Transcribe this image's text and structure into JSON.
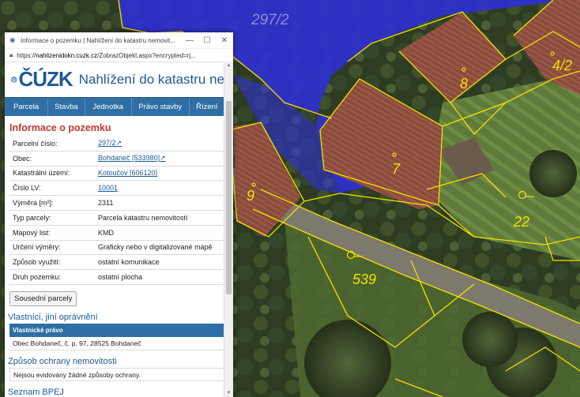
{
  "window": {
    "title": "Informace o pozemku | Nahlížení do katastru nemovit...",
    "url_prefix": "https://",
    "url_host": "nahlizenidokn.cuzk.cz",
    "url_rest": "/ZobrazObjekt.aspx?encrypted=rj..."
  },
  "logo": {
    "brand": "ČÚZK",
    "subtitle": "Nahlížení do katastru ne"
  },
  "nav": [
    "Parcela",
    "Stavba",
    "Jednotka",
    "Právo stavby",
    "Řízení"
  ],
  "section_title": "Informace o pozemku",
  "info": {
    "parcelni_cislo": {
      "label": "Parcelní číslo:",
      "value": "297/2"
    },
    "obec": {
      "label": "Obec:",
      "value": "Bohdaneč [533980]"
    },
    "katastralni_uzemi": {
      "label": "Katastrální území:",
      "value": "Kotoučov [606120]"
    },
    "cislo_lv": {
      "label": "Číslo LV:",
      "value": "10001"
    },
    "vymera": {
      "label": "Výměra [m²]:",
      "value": "2311"
    },
    "typ_parcely": {
      "label": "Typ parcely:",
      "value": "Parcela katastru nemovitostí"
    },
    "mapovy_list": {
      "label": "Mapový list:",
      "value": "KMD"
    },
    "urceni_vymery": {
      "label": "Určení výměry:",
      "value": "Graficky nebo v digitalizované mapě"
    },
    "zpusob_vyuziti": {
      "label": "Způsob využití:",
      "value": "ostatní komunikace"
    },
    "druh_pozemku": {
      "label": "Druh pozemku:",
      "value": "ostatní plocha"
    }
  },
  "buttons": {
    "sousedni": "Sousední parcely"
  },
  "owners": {
    "title": "Vlastníci, jiní oprávnění",
    "header": "Vlastnické právo",
    "row": "Obec Bohdaneč, č. p. 97, 28525 Bohdaneč"
  },
  "protection": {
    "title": "Způsob ochrany nemovitosti",
    "row": "Nejsou evidovány žádné způsoby ochrany."
  },
  "bpej": {
    "title": "Seznam BPEJ"
  },
  "map_labels": {
    "parcel_main": "297/2",
    "b8": "8",
    "b42": "4/2",
    "b7": "7",
    "b9": "9",
    "b22": "22",
    "b539": "539"
  },
  "colors": {
    "accent": "#2f6fa5",
    "heading_red": "#c0392b",
    "parcel_highlight": "#2d2fd6",
    "boundary": "#f2e200"
  }
}
